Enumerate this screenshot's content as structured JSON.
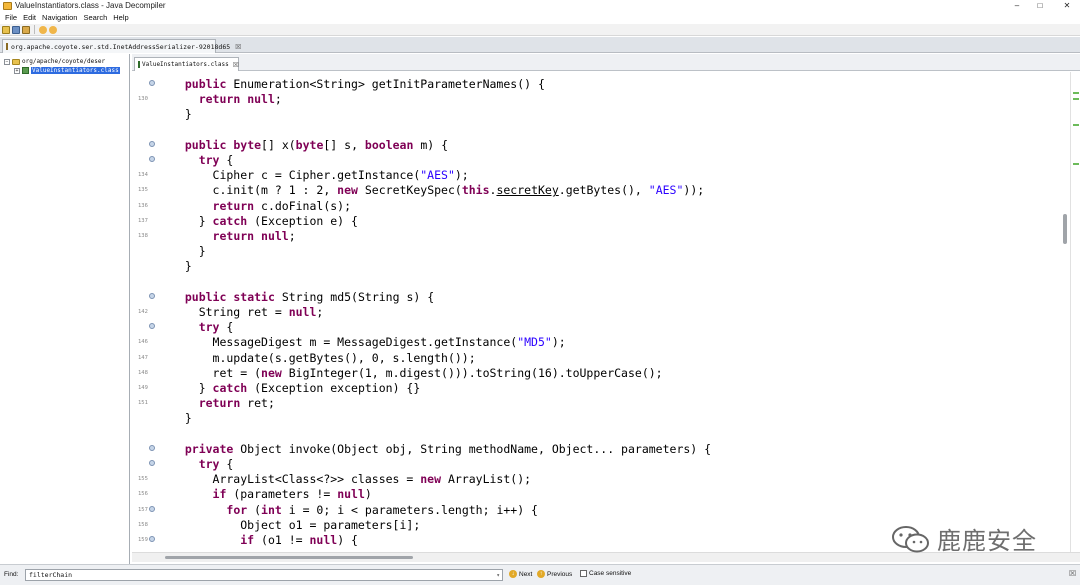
{
  "window": {
    "title": "ValueInstantiators.class - Java Decompiler",
    "minimize": "‒",
    "maximize": "□",
    "close": "✕"
  },
  "menu": [
    "File",
    "Edit",
    "Navigation",
    "Search",
    "Help"
  ],
  "outer_tab": {
    "label": "org.apache.coyote.ser.std.InetAddressSerializer-92018d65",
    "close": "☒"
  },
  "tree": {
    "package_label": "org/apache/coyote/deser",
    "class_label": "ValueInstantiators.class"
  },
  "editor_tab": {
    "label": "ValueInstantiators.class",
    "close": "☒"
  },
  "find": {
    "label": "Find:",
    "value": "filterChain",
    "dropdown": "▾",
    "next_label": "Next",
    "previous_label": "Previous",
    "case_sensitive_label": "Case sensitive",
    "close": "☒"
  },
  "watermark": {
    "text": "鹿鹿安全"
  },
  "colors": {
    "keyword": "#7f0055",
    "string": "#2a00ff",
    "selection": "#2d6be0",
    "overview_mark": "#6cbb5a"
  },
  "code": [
    {
      "ln": "",
      "fold": true,
      "segs": [
        [
          "  ",
          ""
        ],
        [
          "public",
          "kw"
        ],
        [
          " Enumeration<String> getInitParameterNames() {",
          ""
        ]
      ]
    },
    {
      "ln": "130",
      "fold": false,
      "segs": [
        [
          "    ",
          ""
        ],
        [
          "return",
          "kw"
        ],
        [
          " ",
          ""
        ],
        [
          "null",
          "kw"
        ],
        [
          ";",
          ""
        ]
      ]
    },
    {
      "ln": "",
      "fold": false,
      "segs": [
        [
          "  }",
          ""
        ]
      ]
    },
    {
      "ln": "",
      "fold": false,
      "segs": [
        [
          "",
          ""
        ]
      ]
    },
    {
      "ln": "",
      "fold": true,
      "segs": [
        [
          "  ",
          ""
        ],
        [
          "public",
          "kw"
        ],
        [
          " ",
          ""
        ],
        [
          "byte",
          "kw"
        ],
        [
          "[] x(",
          ""
        ],
        [
          "byte",
          "kw"
        ],
        [
          "[] s, ",
          ""
        ],
        [
          "boolean",
          "kw"
        ],
        [
          " m) {",
          ""
        ]
      ]
    },
    {
      "ln": "",
      "fold": true,
      "segs": [
        [
          "    ",
          ""
        ],
        [
          "try",
          "kw"
        ],
        [
          " {",
          ""
        ]
      ]
    },
    {
      "ln": "134",
      "fold": false,
      "segs": [
        [
          "      Cipher c = Cipher.getInstance(",
          ""
        ],
        [
          "\"AES\"",
          "str"
        ],
        [
          ");",
          ""
        ]
      ]
    },
    {
      "ln": "135",
      "fold": false,
      "segs": [
        [
          "      c.init(m ? 1 : 2, ",
          ""
        ],
        [
          "new",
          "kw"
        ],
        [
          " SecretKeySpec(",
          ""
        ],
        [
          "this",
          "kw"
        ],
        [
          ".",
          ""
        ],
        [
          "secretKey",
          "ul"
        ],
        [
          ".getBytes(), ",
          ""
        ],
        [
          "\"AES\"",
          "str"
        ],
        [
          "));",
          ""
        ]
      ]
    },
    {
      "ln": "136",
      "fold": false,
      "segs": [
        [
          "      ",
          ""
        ],
        [
          "return",
          "kw"
        ],
        [
          " c.doFinal(s);",
          ""
        ]
      ]
    },
    {
      "ln": "137",
      "fold": false,
      "segs": [
        [
          "    } ",
          ""
        ],
        [
          "catch",
          "kw"
        ],
        [
          " (Exception e) {",
          ""
        ]
      ]
    },
    {
      "ln": "138",
      "fold": false,
      "segs": [
        [
          "      ",
          ""
        ],
        [
          "return",
          "kw"
        ],
        [
          " ",
          ""
        ],
        [
          "null",
          "kw"
        ],
        [
          ";",
          ""
        ]
      ]
    },
    {
      "ln": "",
      "fold": false,
      "segs": [
        [
          "    }",
          ""
        ]
      ]
    },
    {
      "ln": "",
      "fold": false,
      "segs": [
        [
          "  }",
          ""
        ]
      ]
    },
    {
      "ln": "",
      "fold": false,
      "segs": [
        [
          "",
          ""
        ]
      ]
    },
    {
      "ln": "",
      "fold": true,
      "segs": [
        [
          "  ",
          ""
        ],
        [
          "public",
          "kw"
        ],
        [
          " ",
          ""
        ],
        [
          "static",
          "kw"
        ],
        [
          " String md5(String s) {",
          ""
        ]
      ]
    },
    {
      "ln": "142",
      "fold": false,
      "segs": [
        [
          "    String ret = ",
          ""
        ],
        [
          "null",
          "kw"
        ],
        [
          ";",
          ""
        ]
      ]
    },
    {
      "ln": "",
      "fold": true,
      "segs": [
        [
          "    ",
          ""
        ],
        [
          "try",
          "kw"
        ],
        [
          " {",
          ""
        ]
      ]
    },
    {
      "ln": "146",
      "fold": false,
      "segs": [
        [
          "      MessageDigest m = MessageDigest.getInstance(",
          ""
        ],
        [
          "\"MD5\"",
          "str"
        ],
        [
          ");",
          ""
        ]
      ]
    },
    {
      "ln": "147",
      "fold": false,
      "segs": [
        [
          "      m.update(s.getBytes(), 0, s.length());",
          ""
        ]
      ]
    },
    {
      "ln": "148",
      "fold": false,
      "segs": [
        [
          "      ret = (",
          ""
        ],
        [
          "new",
          "kw"
        ],
        [
          " BigInteger(1, m.digest())).toString(16).toUpperCase();",
          ""
        ]
      ]
    },
    {
      "ln": "149",
      "fold": false,
      "segs": [
        [
          "    } ",
          ""
        ],
        [
          "catch",
          "kw"
        ],
        [
          " (Exception exception) {}",
          ""
        ]
      ]
    },
    {
      "ln": "151",
      "fold": false,
      "segs": [
        [
          "    ",
          ""
        ],
        [
          "return",
          "kw"
        ],
        [
          " ret;",
          ""
        ]
      ]
    },
    {
      "ln": "",
      "fold": false,
      "segs": [
        [
          "  }",
          ""
        ]
      ]
    },
    {
      "ln": "",
      "fold": false,
      "segs": [
        [
          "",
          ""
        ]
      ]
    },
    {
      "ln": "",
      "fold": true,
      "segs": [
        [
          "  ",
          ""
        ],
        [
          "private",
          "kw"
        ],
        [
          " Object invoke(Object obj, String methodName, Object... parameters) {",
          ""
        ]
      ]
    },
    {
      "ln": "",
      "fold": true,
      "segs": [
        [
          "    ",
          ""
        ],
        [
          "try",
          "kw"
        ],
        [
          " {",
          ""
        ]
      ]
    },
    {
      "ln": "155",
      "fold": false,
      "segs": [
        [
          "      ArrayList<Class<?>> classes = ",
          ""
        ],
        [
          "new",
          "kw"
        ],
        [
          " ArrayList();",
          ""
        ]
      ]
    },
    {
      "ln": "156",
      "fold": false,
      "segs": [
        [
          "      ",
          ""
        ],
        [
          "if",
          "kw"
        ],
        [
          " (parameters != ",
          ""
        ],
        [
          "null",
          "kw"
        ],
        [
          ")",
          ""
        ]
      ]
    },
    {
      "ln": "157",
      "fold": true,
      "segs": [
        [
          "        ",
          ""
        ],
        [
          "for",
          "kw"
        ],
        [
          " (",
          ""
        ],
        [
          "int",
          "kw"
        ],
        [
          " i = 0; i < parameters.length; i++) {",
          ""
        ]
      ]
    },
    {
      "ln": "158",
      "fold": false,
      "segs": [
        [
          "          Object o1 = parameters[i];",
          ""
        ]
      ]
    },
    {
      "ln": "159",
      "fold": true,
      "segs": [
        [
          "          ",
          ""
        ],
        [
          "if",
          "kw"
        ],
        [
          " (o1 != ",
          ""
        ],
        [
          "null",
          "kw"
        ],
        [
          ") {",
          ""
        ]
      ]
    }
  ]
}
